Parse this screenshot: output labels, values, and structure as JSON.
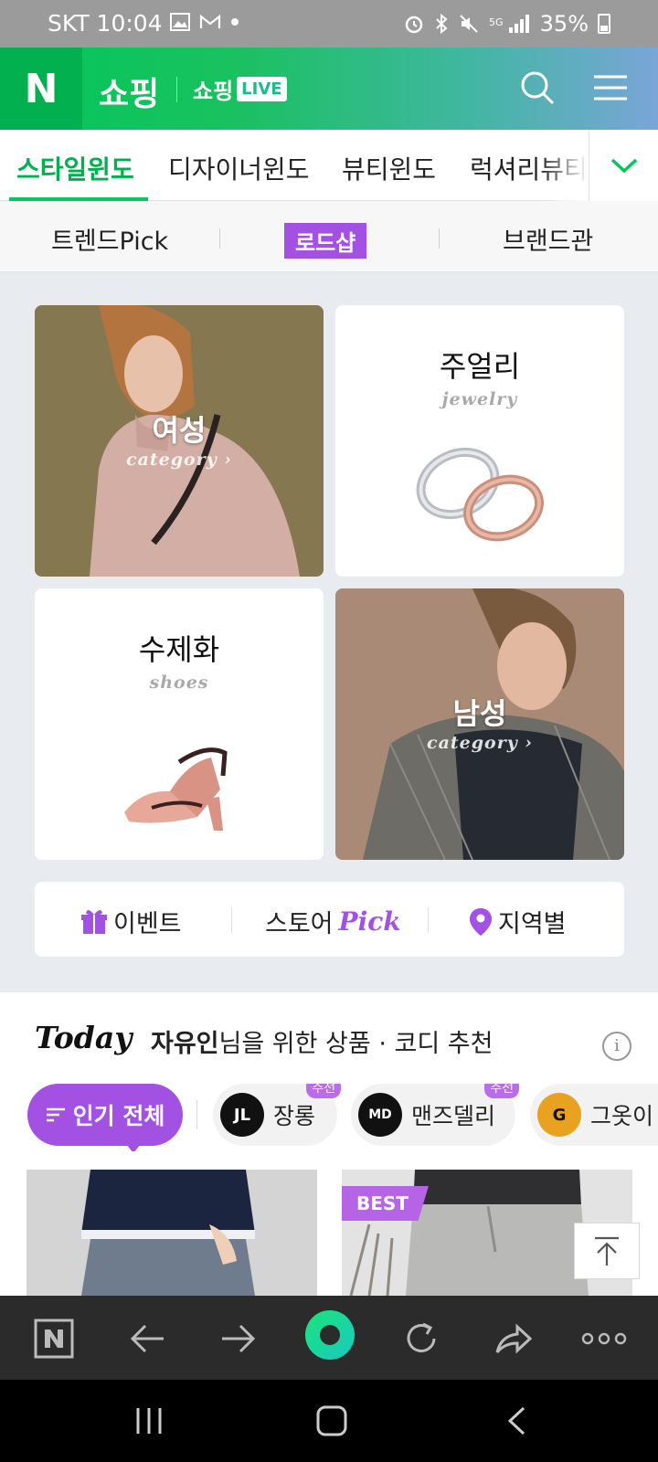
{
  "status": {
    "carrier": "SKT",
    "time": "10:04",
    "battery": "35%"
  },
  "header": {
    "logo": "N",
    "title": "쇼핑",
    "shop_live_text": "쇼핑",
    "live_badge": "LIVE",
    "brand_color": "#03c75a"
  },
  "tabs": [
    {
      "label": "스타일윈도"
    },
    {
      "label": "디자이너윈도"
    },
    {
      "label": "뷰티윈도"
    },
    {
      "label": "럭셔리뷰티"
    }
  ],
  "subnav": [
    {
      "label": "트렌드Pick"
    },
    {
      "label": "로드샵"
    },
    {
      "label": "브랜드관"
    }
  ],
  "categories": [
    {
      "title": "여성",
      "sub": "category ›"
    },
    {
      "title": "주얼리",
      "sub": "jewelry"
    },
    {
      "title": "수제화",
      "sub": "shoes"
    },
    {
      "title": "남성",
      "sub": "category ›"
    }
  ],
  "quick": {
    "event": "이벤트",
    "store": "스토어",
    "pick": "Pick",
    "region": "지역별"
  },
  "today": {
    "title": "Today",
    "user": "자유인",
    "message": "님을 위한 상품 · 코디 추천",
    "info": "i"
  },
  "chips": {
    "all": "인기 전체",
    "items": [
      {
        "name": "장롱",
        "logo": "JL",
        "badge": "추천"
      },
      {
        "name": "맨즈델리",
        "logo": "MD",
        "badge": "추천"
      },
      {
        "name": "그옷이",
        "logo": "G",
        "badge": ""
      }
    ]
  },
  "products": {
    "best_badge": "BEST"
  },
  "accent_color": "#a251e2"
}
